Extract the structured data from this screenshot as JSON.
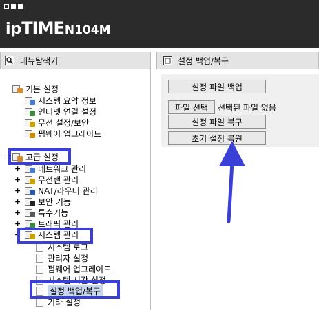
{
  "header": {
    "logo_ip": "ip",
    "logo_time": "TIME",
    "logo_model": "N104M"
  },
  "left_pane": {
    "title": "메뉴탐색기"
  },
  "right_pane": {
    "title": "설정 백업/복구"
  },
  "tree": {
    "basic": {
      "label": "기본 설정",
      "children": [
        "시스템 요약 정보",
        "인터넷 연결 설정",
        "무선 설정/보안",
        "펌웨어 업그레이드"
      ]
    },
    "advanced": {
      "label": "고급 설정",
      "children": [
        "네트워크 관리",
        "무선랜 관리",
        "NAT/라우터 관리",
        "보안 기능",
        "특수기능",
        "트래픽 관리",
        "시스템 관리"
      ]
    },
    "system_children": [
      "시스템 로그",
      "관리자 설정",
      "펌웨어 업그레이드",
      "시스템 시간 설정",
      "설정 백업/복구",
      "기타 설정"
    ]
  },
  "content": {
    "backup_button": "설정 파일 백업",
    "choose_file_button": "파일 선택",
    "no_file_text": "선택된 파일 없음",
    "restore_button": "설정 파일 복구",
    "reset_button": "초기 설정 복원"
  }
}
